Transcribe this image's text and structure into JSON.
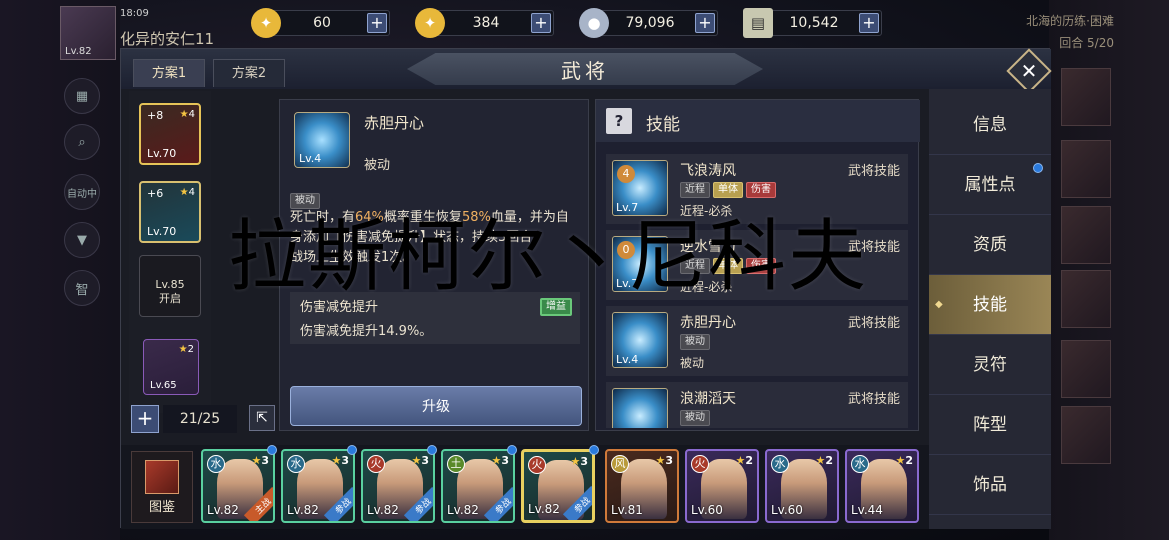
{
  "resources": [
    {
      "icon": "gold-coin-icon",
      "glyph": "✦",
      "value": "60",
      "color": "#e8b83a"
    },
    {
      "icon": "coin-icon",
      "glyph": "✦",
      "value": "384",
      "color": "#e8b83a"
    },
    {
      "icon": "silver-icon",
      "glyph": "●",
      "value": "79,096",
      "color": "#a8b4c8"
    },
    {
      "icon": "scroll-icon",
      "glyph": "▤",
      "value": "10,542",
      "color": "#c8c8b0"
    }
  ],
  "player": {
    "time": "18:09",
    "name": "化异的安仁11",
    "level": "Lv.82"
  },
  "right_header": {
    "line1": "北海的历练·困难",
    "line2": "回合  5/20"
  },
  "left_icons": [
    "自动中",
    "智"
  ],
  "header": {
    "tab1": "方案1",
    "tab2": "方案2",
    "title": "武将"
  },
  "scheme": {
    "slots": [
      {
        "num": "+8",
        "stars": "4",
        "level": "Lv.70"
      },
      {
        "num": "+6",
        "stars": "4",
        "level": "Lv.70"
      }
    ],
    "locked": {
      "level": "Lv.85",
      "label": "开启"
    },
    "slot4": {
      "stars": "2",
      "level": "Lv.65"
    },
    "count": "21/25"
  },
  "detail": {
    "name": "赤胆丹心",
    "level": "Lv.4",
    "type": "被动",
    "tag": "被动",
    "desc_a": "死亡时，有",
    "p1": "64%",
    "desc_b": "概率重生恢复",
    "p2": "58%",
    "desc_c": "血量，并为自身添加【伤害减免提升】状态，持续3回合。",
    "desc_d": "战场上生效触发1次。",
    "sub_title": "伤害减免提升",
    "sub_tag": "增益",
    "sub_desc": "伤害减免提升14.9%。",
    "upgrade": "升级"
  },
  "skills": {
    "title": "技能",
    "help": "?",
    "rows": [
      {
        "name": "飞浪涛风",
        "type": "武将技能",
        "level": "Lv.7",
        "cd": "4",
        "tags": [
          "近程",
          "单体",
          "伤害"
        ],
        "sub": "近程-必杀"
      },
      {
        "name": "逆水雪刀",
        "type": "武将技能",
        "level": "Lv.7",
        "cd": "0",
        "tags": [
          "近程",
          "单体",
          "伤害"
        ],
        "sub": "近程-必杀"
      },
      {
        "name": "赤胆丹心",
        "type": "武将技能",
        "level": "Lv.4",
        "cd": "",
        "tags": [
          "被动"
        ],
        "sub": "被动"
      },
      {
        "name": "浪潮滔天",
        "type": "武将技能",
        "level": "",
        "cd": "",
        "tags": [
          "被动"
        ],
        "sub": ""
      }
    ]
  },
  "nav": [
    "信息",
    "属性点",
    "资质",
    "技能",
    "灵符",
    "阵型",
    "饰品"
  ],
  "roster": {
    "book": "图鉴",
    "heroes": [
      {
        "el": "水",
        "stars": "3",
        "level": "Lv.82",
        "banner": "主战"
      },
      {
        "el": "水",
        "stars": "3",
        "level": "Lv.82",
        "banner": "参战"
      },
      {
        "el": "火",
        "stars": "3",
        "level": "Lv.82",
        "banner": "参战"
      },
      {
        "el": "土",
        "stars": "3",
        "level": "Lv.82",
        "banner": "参战"
      },
      {
        "el": "火",
        "stars": "3",
        "level": "Lv.82",
        "banner": "参战"
      },
      {
        "el": "风",
        "stars": "3",
        "level": "Lv.81",
        "banner": ""
      },
      {
        "el": "火",
        "stars": "2",
        "level": "Lv.60",
        "banner": ""
      },
      {
        "el": "水",
        "stars": "2",
        "level": "Lv.60",
        "banner": ""
      },
      {
        "el": "水",
        "stars": "2",
        "level": "Lv.44",
        "banner": ""
      }
    ]
  },
  "watermark": "拉斯柯尔丶尼科夫"
}
